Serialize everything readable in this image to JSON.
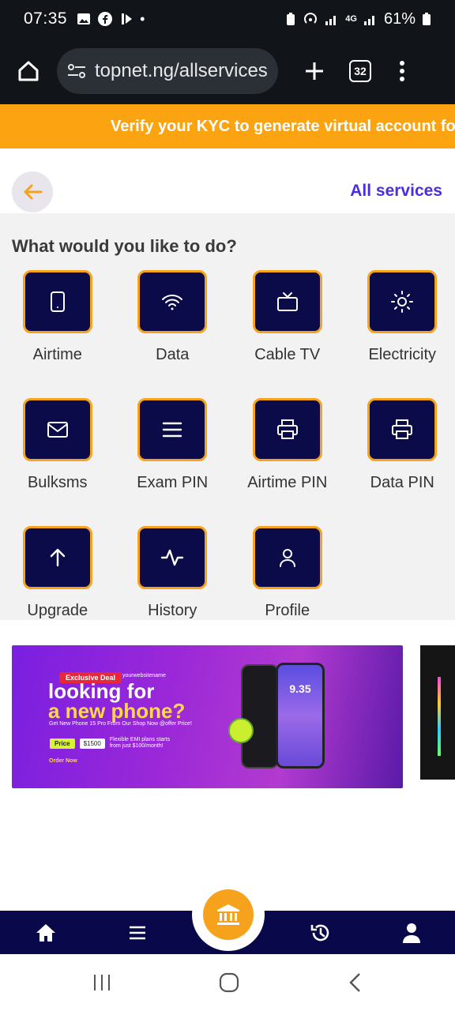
{
  "status_bar": {
    "time": "07:35",
    "battery": "61%",
    "network": "4G"
  },
  "browser": {
    "url": "topnet.ng/allservices",
    "tab_count": "32"
  },
  "banner": {
    "text": "Verify your KYC to generate virtual account fo"
  },
  "header": {
    "title": "All services"
  },
  "services": {
    "heading": "What would you like to do?",
    "items": [
      {
        "label": "Airtime",
        "icon": "phone-icon"
      },
      {
        "label": "Data",
        "icon": "wifi-icon"
      },
      {
        "label": "Cable TV",
        "icon": "tv-icon"
      },
      {
        "label": "Electricity",
        "icon": "sun-icon"
      },
      {
        "label": "Bulksms",
        "icon": "mail-icon"
      },
      {
        "label": "Exam PIN",
        "icon": "menu-lines-icon"
      },
      {
        "label": "Airtime PIN",
        "icon": "printer-icon"
      },
      {
        "label": "Data PIN",
        "icon": "printer-icon"
      },
      {
        "label": "Upgrade",
        "icon": "arrow-up-icon"
      },
      {
        "label": "History",
        "icon": "activity-icon"
      },
      {
        "label": "Profile",
        "icon": "user-icon"
      }
    ]
  },
  "promo": {
    "badge": "Exclusive Deal",
    "site": "yourwebsitename",
    "headline_1": "looking for",
    "headline_2": "a new phone?",
    "sub": "Get New Phone 15 Pro From Our Shop Now @offer Price!",
    "price_label": "Price",
    "price_value": "$1500",
    "emi": "Flexible EMI plans starts from just $100/month!",
    "order": "Order Now",
    "phone_time": "9.35"
  },
  "colors": {
    "accent": "#f6a21c",
    "navy": "#0b0b4a",
    "title": "#4a2fe0"
  }
}
